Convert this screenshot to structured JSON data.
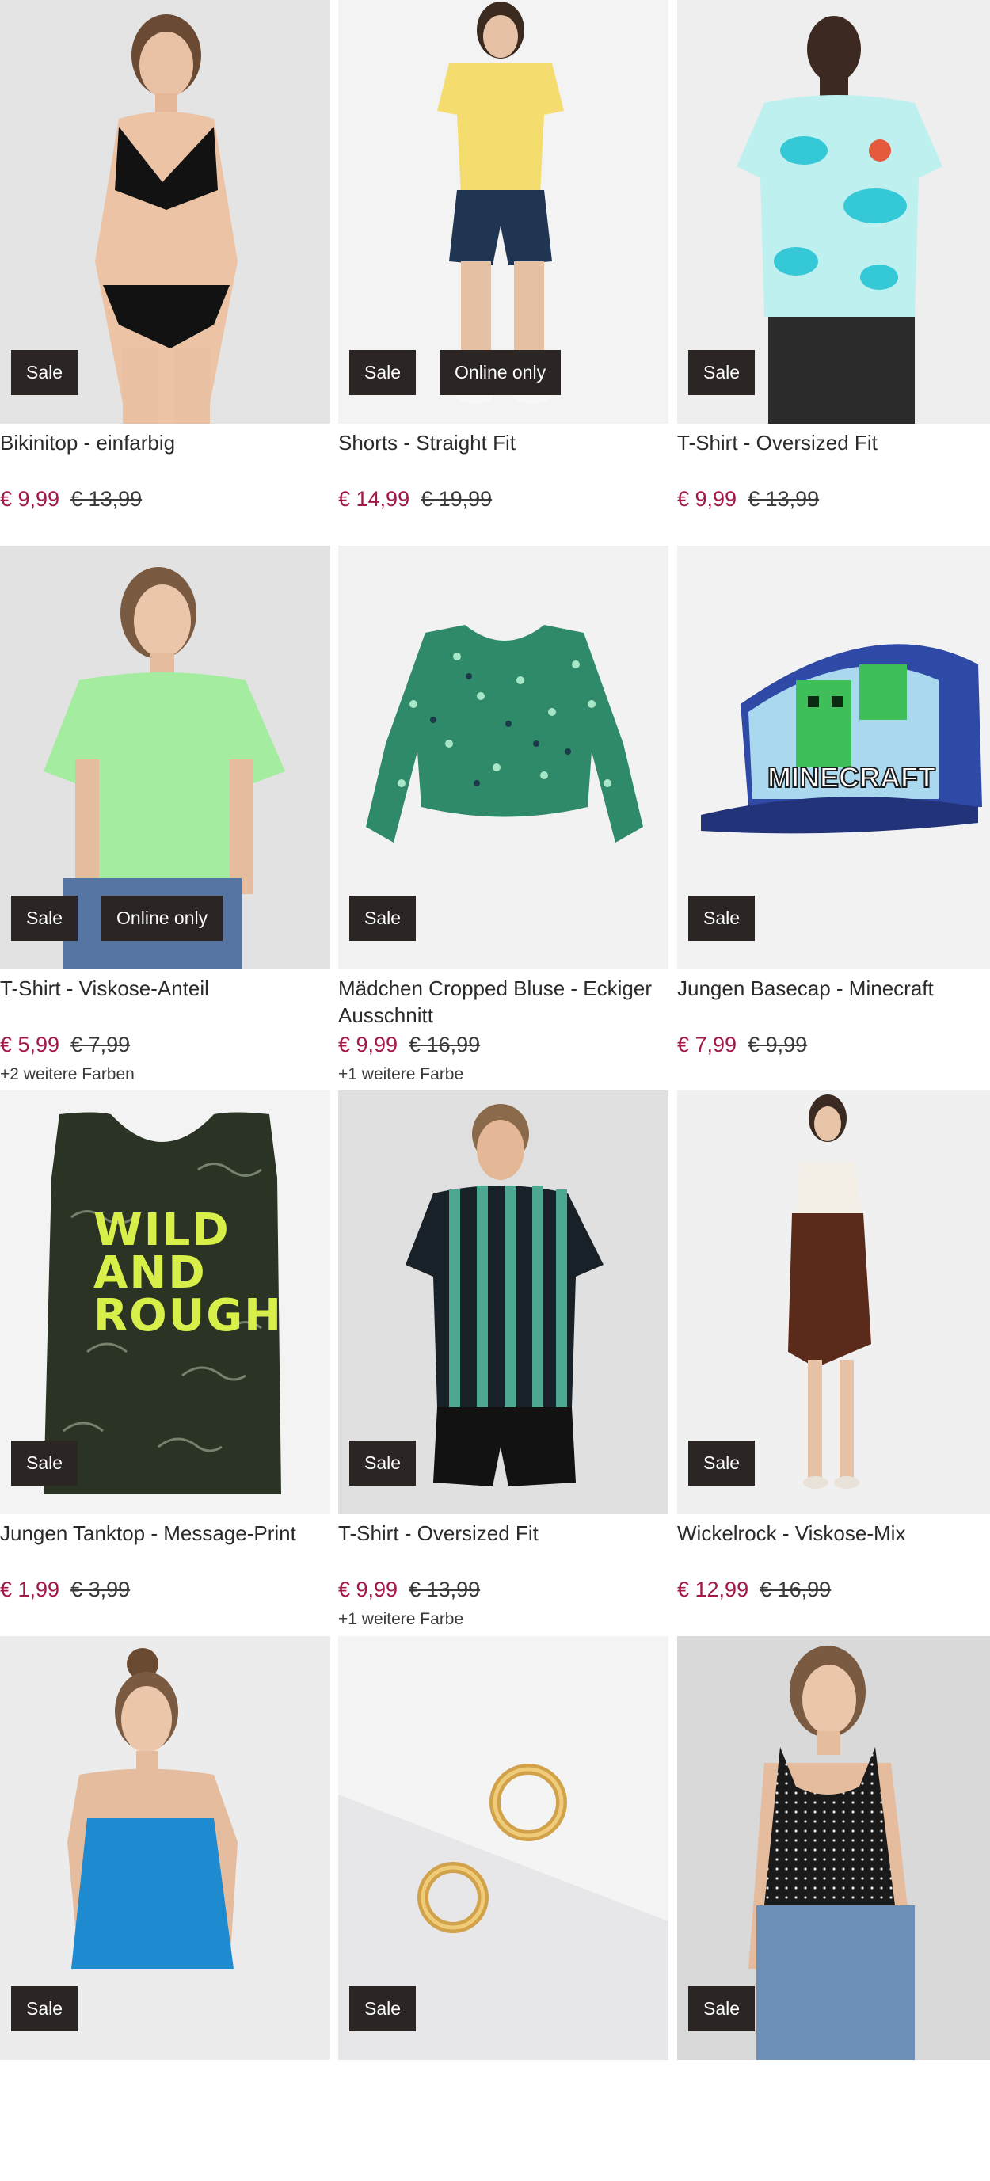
{
  "colors": {
    "price": "#a3174a",
    "badge_bg": "#2b2523",
    "badge_text": "#ffffff"
  },
  "products": [
    {
      "name": "Bikinitop - einfarbig",
      "badges": [
        "Sale"
      ],
      "price": "€ 9,99",
      "old_price": "€ 13,99",
      "colors_note": "",
      "image": "woman-black-bikini"
    },
    {
      "name": "Shorts - Straight Fit",
      "badges": [
        "Sale",
        "Online only"
      ],
      "price": "€ 14,99",
      "old_price": "€ 19,99",
      "colors_note": "",
      "image": "woman-yellow-tee-denim-shorts"
    },
    {
      "name": "T-Shirt - Oversized Fit",
      "badges": [
        "Sale"
      ],
      "price": "€ 9,99",
      "old_price": "€ 13,99",
      "colors_note": "",
      "image": "man-turquoise-tie-dye-tee"
    },
    {
      "name": "T-Shirt - Viskose-Anteil",
      "badges": [
        "Sale",
        "Online only"
      ],
      "price": "€ 5,99",
      "old_price": "€ 7,99",
      "colors_note": "+2 weitere Farben",
      "image": "woman-mint-green-tee"
    },
    {
      "name": "Mädchen Cropped Bluse - Eckiger Ausschnitt",
      "badges": [
        "Sale"
      ],
      "price": "€ 9,99",
      "old_price": "€ 16,99",
      "colors_note": "+1 weitere Farbe",
      "image": "green-floral-cropped-blouse"
    },
    {
      "name": "Jungen Basecap - Minecraft",
      "badges": [
        "Sale"
      ],
      "price": "€ 7,99",
      "old_price": "€ 9,99",
      "colors_note": "",
      "image": "blue-minecraft-cap"
    },
    {
      "name": "Jungen Tanktop - Message-Print",
      "badges": [
        "Sale"
      ],
      "price": "€ 1,99",
      "old_price": "€ 3,99",
      "colors_note": "",
      "image": "dino-print-tanktop",
      "print_text": [
        "WILD",
        "AND",
        "ROUGH"
      ]
    },
    {
      "name": "T-Shirt - Oversized Fit",
      "badges": [
        "Sale"
      ],
      "price": "€ 9,99",
      "old_price": "€ 13,99",
      "colors_note": "+1 weitere Farbe",
      "image": "man-striped-tee"
    },
    {
      "name": "Wickelrock - Viskose-Mix",
      "badges": [
        "Sale"
      ],
      "price": "€ 12,99",
      "old_price": "€ 16,99",
      "colors_note": "",
      "image": "woman-brown-wrap-skirt"
    },
    {
      "name": "",
      "badges": [
        "Sale"
      ],
      "price": "",
      "old_price": "",
      "colors_note": "",
      "image": "woman-blue-top"
    },
    {
      "name": "",
      "badges": [
        "Sale"
      ],
      "price": "",
      "old_price": "",
      "colors_note": "",
      "image": "gold-hoop-earrings"
    },
    {
      "name": "",
      "badges": [
        "Sale"
      ],
      "price": "",
      "old_price": "",
      "colors_note": "",
      "image": "woman-polka-dot-top"
    }
  ]
}
